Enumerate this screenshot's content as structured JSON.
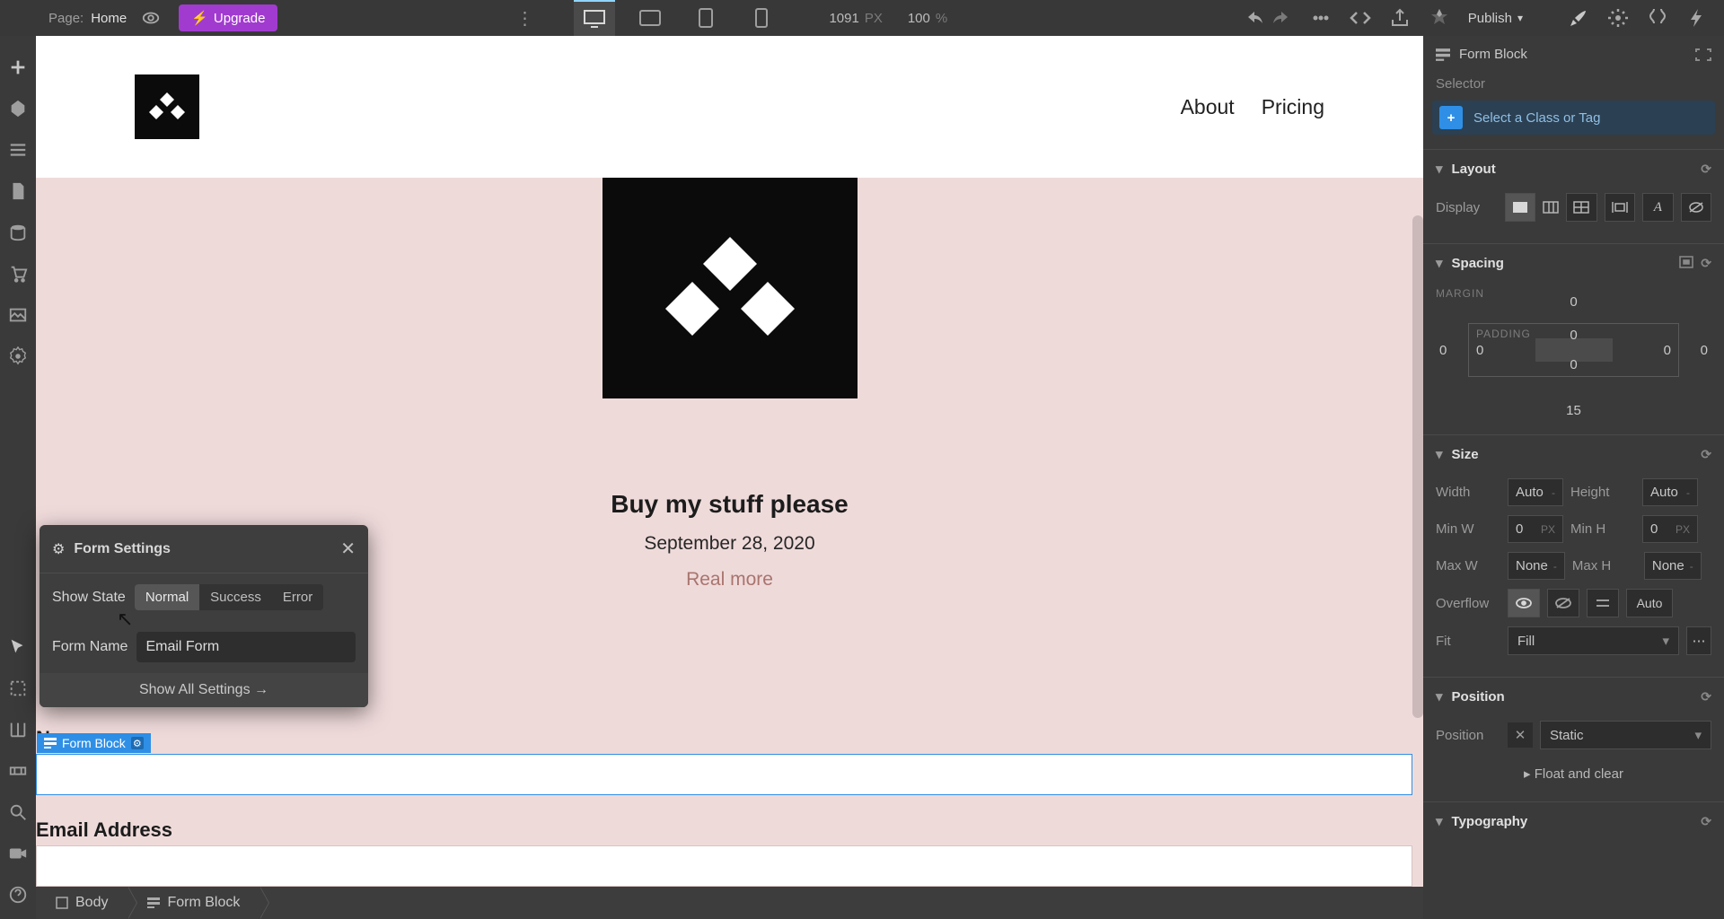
{
  "topbar": {
    "page_label": "Page:",
    "page_name": "Home",
    "upgrade": "Upgrade",
    "width_value": "1091",
    "width_unit": "PX",
    "zoom_value": "100",
    "zoom_unit": "%",
    "publish": "Publish"
  },
  "canvas": {
    "nav": {
      "about": "About",
      "pricing": "Pricing"
    },
    "hero": {
      "headline": "Buy my stuff please",
      "date": "September 28, 2020",
      "link": "Real more"
    },
    "form": {
      "name_label": "Name",
      "email_label": "Email Address",
      "tag": "Form Block"
    }
  },
  "popover": {
    "title": "Form Settings",
    "show_state_label": "Show State",
    "states": {
      "normal": "Normal",
      "success": "Success",
      "error": "Error"
    },
    "form_name_label": "Form Name",
    "form_name_value": "Email Form",
    "show_all": "Show All Settings  →"
  },
  "breadcrumb": {
    "body": "Body",
    "form_block": "Form Block"
  },
  "panel": {
    "element": "Form Block",
    "selector_label": "Selector",
    "selector_placeholder": "Select a Class or Tag",
    "sections": {
      "layout": "Layout",
      "spacing": "Spacing",
      "size": "Size",
      "position": "Position",
      "typography": "Typography"
    },
    "display_label": "Display",
    "spacing": {
      "margin_label": "MARGIN",
      "padding_label": "PADDING",
      "m_top": "0",
      "m_right": "0",
      "m_bottom": "15",
      "m_left": "0",
      "p_top": "0",
      "p_right": "0",
      "p_bottom": "0",
      "p_left": "0"
    },
    "size": {
      "width_label": "Width",
      "width_val": "Auto",
      "width_unit": "-",
      "height_label": "Height",
      "height_val": "Auto",
      "height_unit": "-",
      "minw_label": "Min W",
      "minw_val": "0",
      "minw_unit": "PX",
      "minh_label": "Min H",
      "minh_val": "0",
      "minh_unit": "PX",
      "maxw_label": "Max W",
      "maxw_val": "None",
      "maxw_unit": "-",
      "maxh_label": "Max H",
      "maxh_val": "None",
      "maxh_unit": "-",
      "overflow_label": "Overflow",
      "overflow_auto": "Auto",
      "fit_label": "Fit",
      "fit_val": "Fill"
    },
    "position": {
      "label": "Position",
      "value": "Static",
      "float_label": "Float and clear"
    }
  }
}
